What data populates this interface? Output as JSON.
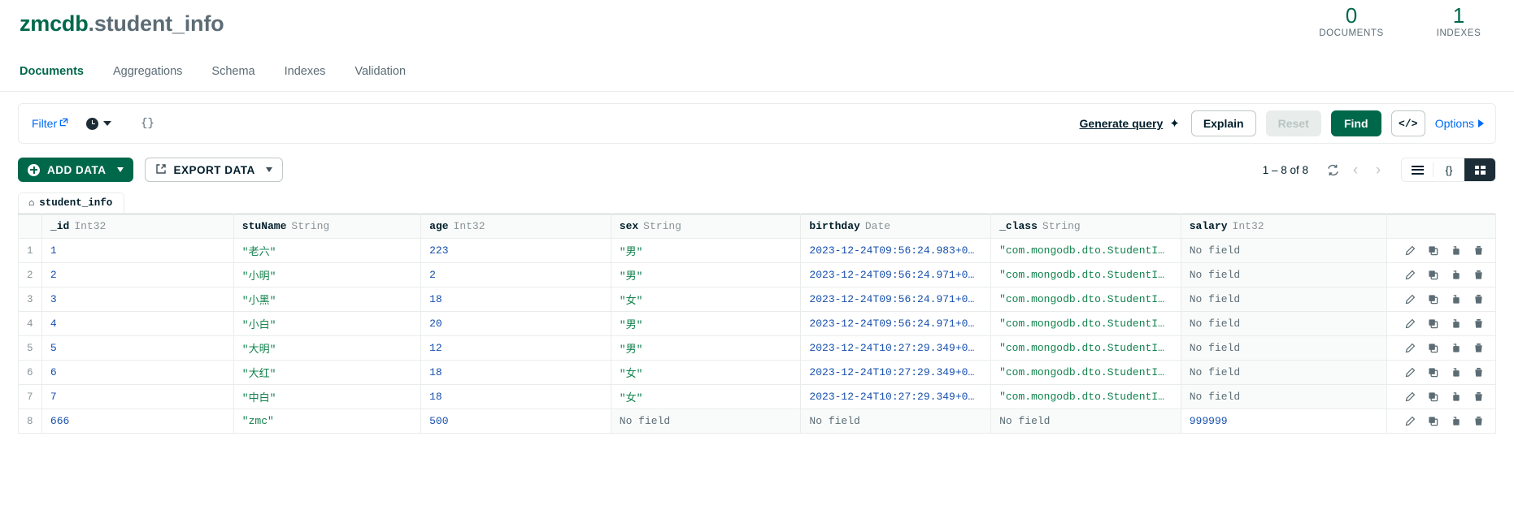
{
  "header": {
    "database": "zmcdb",
    "collection": ".student_info",
    "stats": [
      {
        "value": "0",
        "label": "DOCUMENTS"
      },
      {
        "value": "1",
        "label": "INDEXES"
      }
    ]
  },
  "nav_tabs": [
    {
      "label": "Documents",
      "active": true
    },
    {
      "label": "Aggregations",
      "active": false
    },
    {
      "label": "Schema",
      "active": false
    },
    {
      "label": "Indexes",
      "active": false
    },
    {
      "label": "Validation",
      "active": false
    }
  ],
  "query_bar": {
    "filter_label": "Filter",
    "filter_value": "{}",
    "generate_query_label": "Generate query",
    "explain_label": "Explain",
    "reset_label": "Reset",
    "find_label": "Find",
    "code_label": "</>",
    "options_label": "Options"
  },
  "toolbar": {
    "add_data_label": "ADD DATA",
    "export_data_label": "EXPORT DATA",
    "result_count": "1 – 8 of 8"
  },
  "table": {
    "collection_tab": "student_info",
    "columns": [
      {
        "name": "_id",
        "type": "Int32"
      },
      {
        "name": "stuName",
        "type": "String"
      },
      {
        "name": "age",
        "type": "Int32"
      },
      {
        "name": "sex",
        "type": "String"
      },
      {
        "name": "birthday",
        "type": "Date"
      },
      {
        "name": "_class",
        "type": "String"
      },
      {
        "name": "salary",
        "type": "Int32"
      }
    ],
    "rows": [
      {
        "num": "1",
        "_id": "1",
        "stuName": "\"老六\"",
        "age": "223",
        "sex": "\"男\"",
        "birthday": "2023-12-24T09:56:24.983+0…",
        "_class": "\"com.mongodb.dto.StudentI…",
        "salary": "No field"
      },
      {
        "num": "2",
        "_id": "2",
        "stuName": "\"小明\"",
        "age": "2",
        "sex": "\"男\"",
        "birthday": "2023-12-24T09:56:24.971+0…",
        "_class": "\"com.mongodb.dto.StudentI…",
        "salary": "No field"
      },
      {
        "num": "3",
        "_id": "3",
        "stuName": "\"小黑\"",
        "age": "18",
        "sex": "\"女\"",
        "birthday": "2023-12-24T09:56:24.971+0…",
        "_class": "\"com.mongodb.dto.StudentI…",
        "salary": "No field"
      },
      {
        "num": "4",
        "_id": "4",
        "stuName": "\"小白\"",
        "age": "20",
        "sex": "\"男\"",
        "birthday": "2023-12-24T09:56:24.971+0…",
        "_class": "\"com.mongodb.dto.StudentI…",
        "salary": "No field"
      },
      {
        "num": "5",
        "_id": "5",
        "stuName": "\"大明\"",
        "age": "12",
        "sex": "\"男\"",
        "birthday": "2023-12-24T10:27:29.349+0…",
        "_class": "\"com.mongodb.dto.StudentI…",
        "salary": "No field"
      },
      {
        "num": "6",
        "_id": "6",
        "stuName": "\"大红\"",
        "age": "18",
        "sex": "\"女\"",
        "birthday": "2023-12-24T10:27:29.349+0…",
        "_class": "\"com.mongodb.dto.StudentI…",
        "salary": "No field"
      },
      {
        "num": "7",
        "_id": "7",
        "stuName": "\"中白\"",
        "age": "18",
        "sex": "\"女\"",
        "birthday": "2023-12-24T10:27:29.349+0…",
        "_class": "\"com.mongodb.dto.StudentI…",
        "salary": "No field"
      },
      {
        "num": "8",
        "_id": "666",
        "stuName": "\"zmc\"",
        "age": "500",
        "sex": "No field",
        "birthday": "No field",
        "_class": "No field",
        "salary": "999999"
      }
    ]
  },
  "colors": {
    "brand_green": "#00684a",
    "accent_green": "#00a35c",
    "link_blue": "#016bf8",
    "value_number": "#1750ac",
    "value_string": "#12824d",
    "highlight_red": "#ea4335"
  }
}
